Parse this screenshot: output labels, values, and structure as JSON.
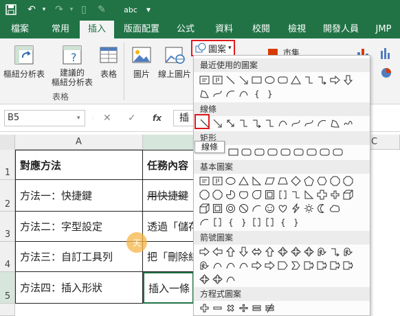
{
  "quick_access": {
    "save_icon": "save-icon",
    "undo_icon": "undo-icon",
    "redo_icon": "redo-icon",
    "abc_label": "abc"
  },
  "tabs": [
    {
      "label": "檔案"
    },
    {
      "label": "常用"
    },
    {
      "label": "插入"
    },
    {
      "label": "版面配置"
    },
    {
      "label": "公式"
    },
    {
      "label": "資料"
    },
    {
      "label": "校閱"
    },
    {
      "label": "檢視"
    },
    {
      "label": "開發人員"
    },
    {
      "label": "JMP"
    }
  ],
  "ribbon": {
    "pivot_label": "樞紐分析表",
    "recommended_pivot_line1": "建議的",
    "recommended_pivot_line2": "樞紐分析表",
    "table_label": "表格",
    "group_table": "表格",
    "picture_label": "圖片",
    "online_picture_label": "線上圖片",
    "shapes_label": "圖案",
    "store_label": "市集"
  },
  "formula_bar": {
    "name_box": "B5",
    "cancel": "✕",
    "enter": "✓",
    "fx": "fx",
    "content": "插"
  },
  "sheet": {
    "col_a": "A",
    "col_c": "C",
    "rows": [
      {
        "num": "1",
        "a": "對應方法",
        "b": "任務內容"
      },
      {
        "num": "2",
        "a": "方法一：快捷鍵",
        "b": "用快捷鍵"
      },
      {
        "num": "3",
        "a": "方法二：字型設定",
        "b": "透過「儲存"
      },
      {
        "num": "4",
        "a": "方法三：自訂工具列",
        "b": "把「刪除線"
      },
      {
        "num": "5",
        "a": "方法四：插入形狀",
        "b": "插入一條"
      }
    ]
  },
  "dropdown": {
    "sections": [
      {
        "title": "最近使用的圖案"
      },
      {
        "title": "線條"
      },
      {
        "title": "矩形"
      },
      {
        "title": "基本圖案"
      },
      {
        "title": "箭號圖案"
      },
      {
        "title": "方程式圖案"
      }
    ],
    "tooltip": "線條",
    "cursor_icon_label": "天"
  },
  "colors": {
    "brand": "#217346",
    "highlight": "#e0191e",
    "cursor": "#f6b446"
  }
}
